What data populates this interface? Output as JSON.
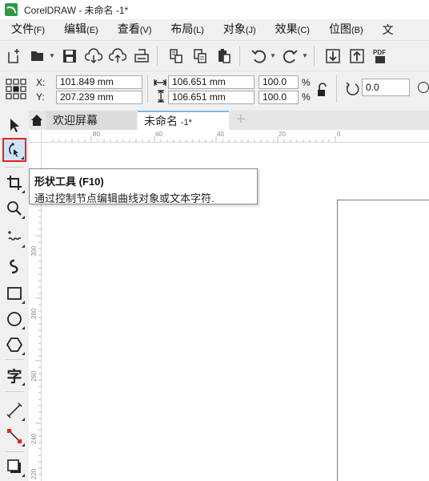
{
  "titlebar": {
    "title": "CorelDRAW - 未命名 -1*"
  },
  "menu": [
    {
      "label": "文件",
      "key": "(F)"
    },
    {
      "label": "编辑",
      "key": "(E)"
    },
    {
      "label": "查看",
      "key": "(V)"
    },
    {
      "label": "布局",
      "key": "(L)"
    },
    {
      "label": "对象",
      "key": "(J)"
    },
    {
      "label": "效果",
      "key": "(C)"
    },
    {
      "label": "位图",
      "key": "(B)"
    },
    {
      "label": "文"
    }
  ],
  "toolbar": {
    "icons": [
      "new-document-icon",
      "open-folder-icon",
      "save-icon",
      "cloud-download-icon",
      "cloud-upload-icon",
      "print-icon",
      "cut-icon",
      "copy-icon",
      "paste-icon",
      "undo-icon",
      "redo-icon",
      "import-icon",
      "export-icon",
      "pdf-icon"
    ],
    "pdf_label": "PDF"
  },
  "properties": {
    "x_label": "X:",
    "y_label": "Y:",
    "x_value": "101.849 mm",
    "y_value": "207.239 mm",
    "width_value": "106.651 mm",
    "height_value": "106.651 mm",
    "scale_x": "100.0",
    "scale_y": "100.0",
    "percent": "%",
    "rotation": "0.0"
  },
  "tabs": {
    "welcome": "欢迎屏幕",
    "document": "未命名",
    "document_suffix": "-1*",
    "add": "+"
  },
  "ruler": {
    "top": [
      "80",
      "60",
      "40",
      "20",
      "0"
    ],
    "left": [
      "300",
      "280",
      "260",
      "240",
      "220"
    ]
  },
  "toolbox": {
    "selected_tool": "shape-tool",
    "text_tool_glyph": "字"
  },
  "tooltip": {
    "title": "形状工具 (F10)",
    "body": "通过控制节点编辑曲线对象或文本字符."
  }
}
